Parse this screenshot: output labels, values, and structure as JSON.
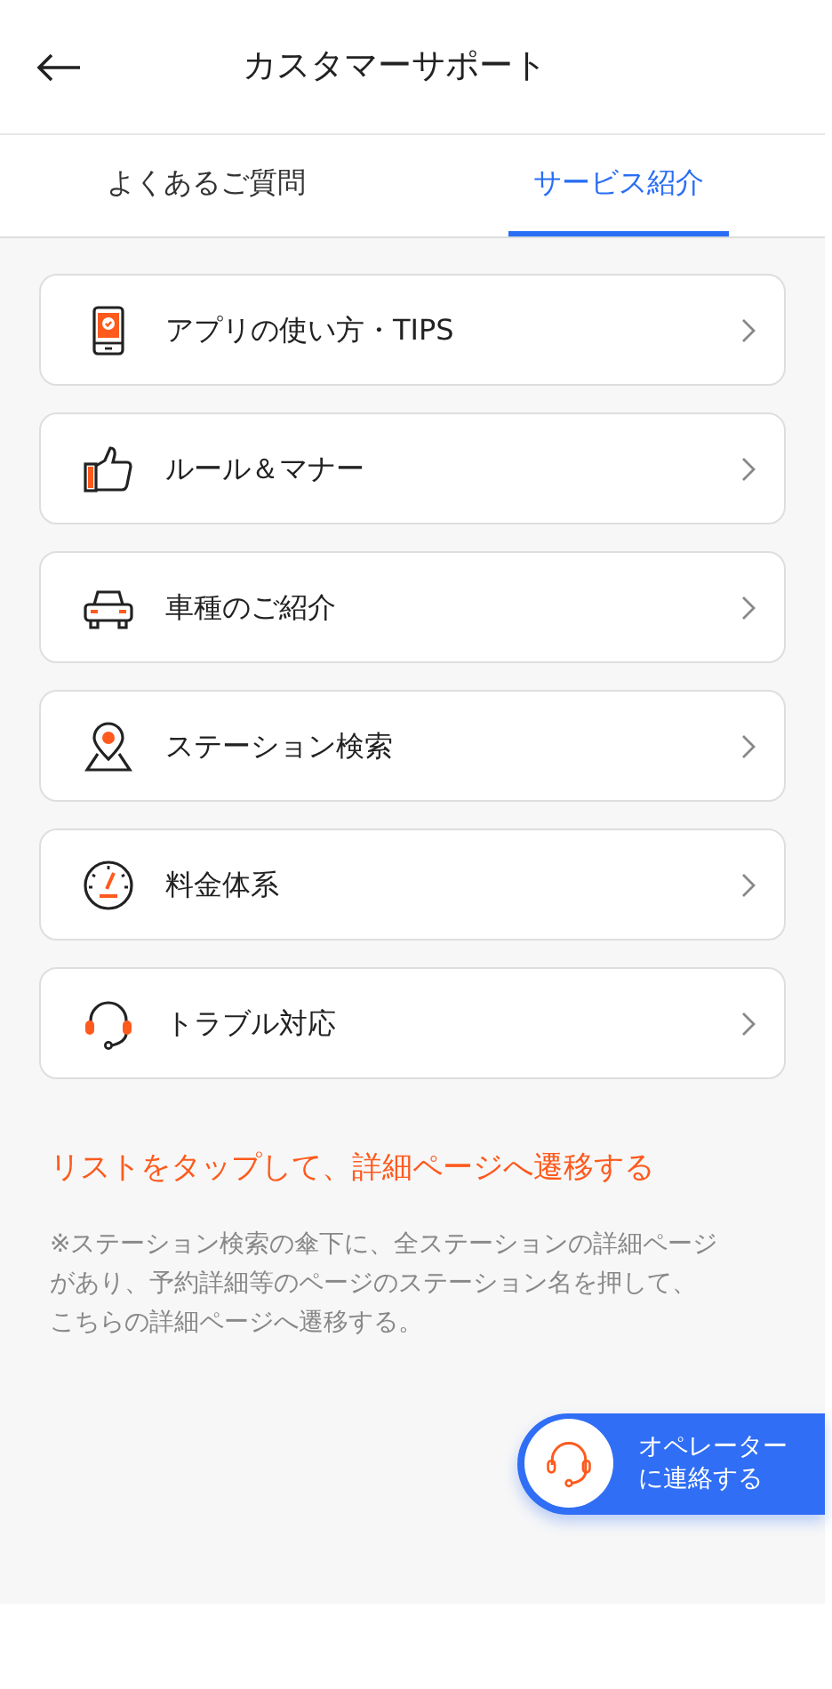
{
  "header": {
    "title": "カスタマーサポート"
  },
  "tabs": [
    {
      "label": "よくあるご質問",
      "selected": false
    },
    {
      "label": "サービス紹介",
      "selected": true
    }
  ],
  "menu_items": [
    {
      "label": "アプリの使い方・TIPS",
      "kind": "phone"
    },
    {
      "label": "ルール＆マナー",
      "kind": "thumb"
    },
    {
      "label": "車種のご紹介",
      "kind": "car"
    },
    {
      "label": "ステーション検索",
      "kind": "pin"
    },
    {
      "label": "料金体系",
      "kind": "gauge"
    },
    {
      "label": "トラブル対応",
      "kind": "headset"
    }
  ],
  "note_title": "リストをタップして、詳細ページへ遷移する",
  "note_lines": [
    "※ステーション検索の傘下に、全ステーションの詳細ページ",
    "があり、予約詳細等のページのステーション名を押して、",
    "こちらの詳細ページへ遷移する。"
  ],
  "operator_button": {
    "lines": [
      "オペレーター",
      "に連絡する"
    ]
  }
}
